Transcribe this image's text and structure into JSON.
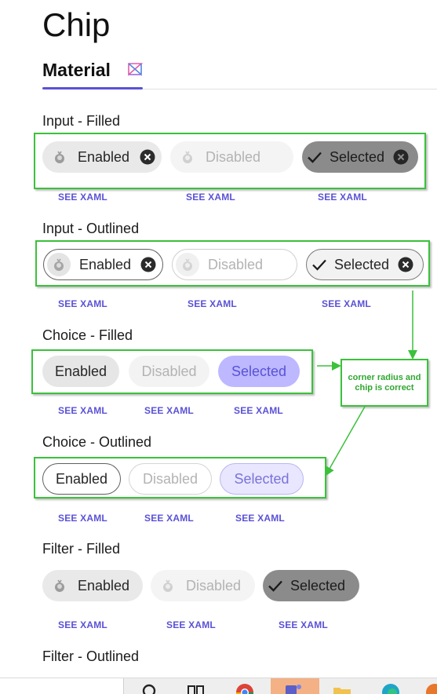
{
  "page": {
    "title": "Chip"
  },
  "tab": {
    "label": "Material"
  },
  "sections": [
    {
      "title": "Input - Filled"
    },
    {
      "title": "Input - Outlined"
    },
    {
      "title": "Choice - Filled"
    },
    {
      "title": "Choice - Outlined"
    },
    {
      "title": "Filter - Filled"
    },
    {
      "title": "Filter - Outlined"
    }
  ],
  "chips": {
    "enabled": "Enabled",
    "disabled": "Disabled",
    "selected": "Selected"
  },
  "link": {
    "see_xaml": "SEE XAML"
  },
  "annotation": {
    "note": "corner radius and chip is correct"
  },
  "colors": {
    "accent": "#5a52d5",
    "annotation_green": "#3bc13b",
    "selected_fill": "#bdb8ff"
  },
  "icons": [
    "avatar-icon",
    "close-circle-icon",
    "check-icon",
    "material-logo-icon"
  ]
}
